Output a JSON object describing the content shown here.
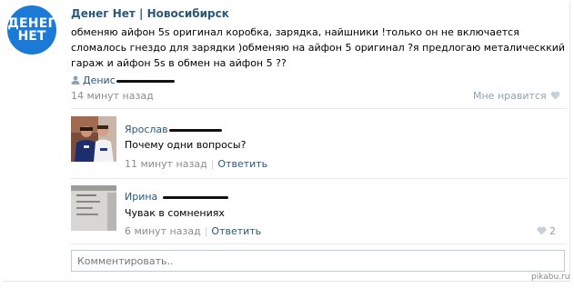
{
  "post": {
    "group_logo_line1": "ДЕНЕГ",
    "group_logo_line2": "НЕТ",
    "group_name": "Денег Нет | Новосибирск",
    "text": "обменяю айфон 5s оригинал коробка, зарядка, найшники !только он не включается сломалось гнездо для зарядки )обменяю на айфон 5 оригинал ?я предлогаю металическкий гараж и айфон 5s в обмен на айфон 5 ??",
    "author": "Денис",
    "time": "14 минут назад",
    "like_label": "Мне нравится"
  },
  "comments": [
    {
      "name": "Ярослав",
      "text": "Почему одни вопросы?",
      "time": "11 минут назад",
      "reply": "Ответить",
      "avatar": "photo-two-men-football-kit"
    },
    {
      "name": "Ирина",
      "text": "Чувак в сомнениях",
      "time": "6 минут назад",
      "reply": "Ответить",
      "likes": "2",
      "avatar": "photo-handwritten-notes"
    }
  ],
  "comment_box": {
    "placeholder": "Комментировать.."
  },
  "watermark": "pikabu.ru",
  "colors": {
    "link": "#2b587a",
    "logo_bg": "#1a7ad6",
    "meta": "#8c8c8c",
    "like": "#8fa1b3"
  }
}
